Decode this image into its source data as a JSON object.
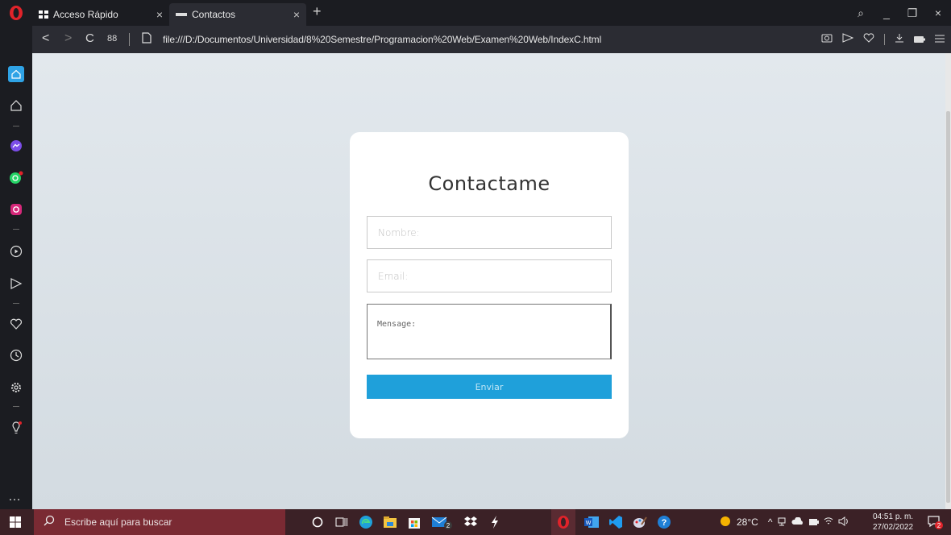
{
  "browser": {
    "tabs": [
      {
        "label": "Acceso Rápido",
        "close": "×"
      },
      {
        "label": "Contactos",
        "close": "×"
      }
    ],
    "new_tab": "+",
    "window_controls": {
      "search": "⌕",
      "minimize": "_",
      "restore": "❐",
      "close": "×"
    },
    "address": {
      "back": "<",
      "forward": ">",
      "reload": "C",
      "speed_dial": "88",
      "url": "file:///D:/Documentos/Universidad/8%20Semestre/Programacion%20Web/Examen%20Web/IndexC.html"
    },
    "sidebar_icons": [
      "home-icon",
      "speed-dial-star-icon",
      "messenger-icon",
      "whatsapp-icon",
      "instagram-icon",
      "player-icon",
      "send-icon",
      "heart-icon",
      "history-icon",
      "settings-icon",
      "bulb-icon"
    ],
    "sidebar_more": "…"
  },
  "form": {
    "title": "Contactame",
    "nombre_placeholder": "Nombre:",
    "email_placeholder": "Email:",
    "mensaje_placeholder": "Mensage:",
    "submit_label": "Enviar"
  },
  "taskbar": {
    "search_text": "Escribe aquí para buscar",
    "weather": "28°C",
    "time": "04:51 p. m.",
    "date": "27/02/2022",
    "badge_store": "2",
    "badge_notifications": "2"
  },
  "colors": {
    "accent": "#1fa0da",
    "taskbar": "#3b2126",
    "search": "#7a2a33",
    "opera": "#e0232a"
  }
}
